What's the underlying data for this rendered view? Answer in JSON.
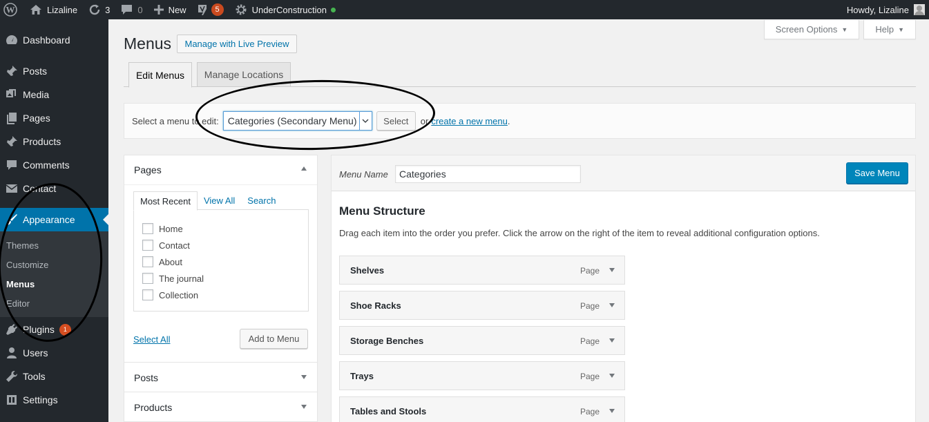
{
  "admin_bar": {
    "site_name": "Lizaline",
    "updates_count": "3",
    "comments_count": "0",
    "new_label": "New",
    "yoast_count": "5",
    "under_construction_label": "UnderConstruction",
    "howdy": "Howdy, Lizaline"
  },
  "sidebar": {
    "items": [
      {
        "label": "Dashboard"
      },
      {
        "label": "Posts"
      },
      {
        "label": "Media"
      },
      {
        "label": "Pages"
      },
      {
        "label": "Products"
      },
      {
        "label": "Comments"
      },
      {
        "label": "Contact"
      },
      {
        "label": "Appearance"
      },
      {
        "label": "Plugins",
        "badge": "1"
      },
      {
        "label": "Users"
      },
      {
        "label": "Tools"
      },
      {
        "label": "Settings"
      }
    ],
    "appearance_submenu": [
      "Themes",
      "Customize",
      "Menus",
      "Editor"
    ]
  },
  "screen_meta": {
    "screen_options": "Screen Options",
    "help": "Help"
  },
  "page": {
    "title": "Menus",
    "live_preview_button": "Manage with Live Preview",
    "tabs": [
      "Edit Menus",
      "Manage Locations"
    ]
  },
  "manage_menus": {
    "label": "Select a menu to edit:",
    "selected_menu": "Categories (Secondary Menu)",
    "select_button": "Select",
    "or_text": "or",
    "create_link": "create a new menu",
    "trailing_period": "."
  },
  "add_items": {
    "pages_title": "Pages",
    "panel_tabs": [
      "Most Recent",
      "View All",
      "Search"
    ],
    "page_items": [
      "Home",
      "Contact",
      "About",
      "The journal",
      "Collection"
    ],
    "select_all": "Select All",
    "add_to_menu": "Add to Menu",
    "posts_title": "Posts",
    "products_title": "Products"
  },
  "menu_edit": {
    "menu_name_label": "Menu Name",
    "menu_name_value": "Categories",
    "save_button": "Save Menu",
    "structure_title": "Menu Structure",
    "structure_desc": "Drag each item into the order you prefer. Click the arrow on the right of the item to reveal additional configuration options.",
    "items": [
      {
        "title": "Shelves",
        "type": "Page"
      },
      {
        "title": "Shoe Racks",
        "type": "Page"
      },
      {
        "title": "Storage Benches",
        "type": "Page"
      },
      {
        "title": "Trays",
        "type": "Page"
      },
      {
        "title": "Tables and Stools",
        "type": "Page"
      }
    ]
  },
  "colors": {
    "admin_bar_bg": "#23282d",
    "accent_blue": "#0073aa",
    "primary_button": "#0085ba",
    "badge_red": "#d54e21",
    "status_green": "#46b450"
  }
}
